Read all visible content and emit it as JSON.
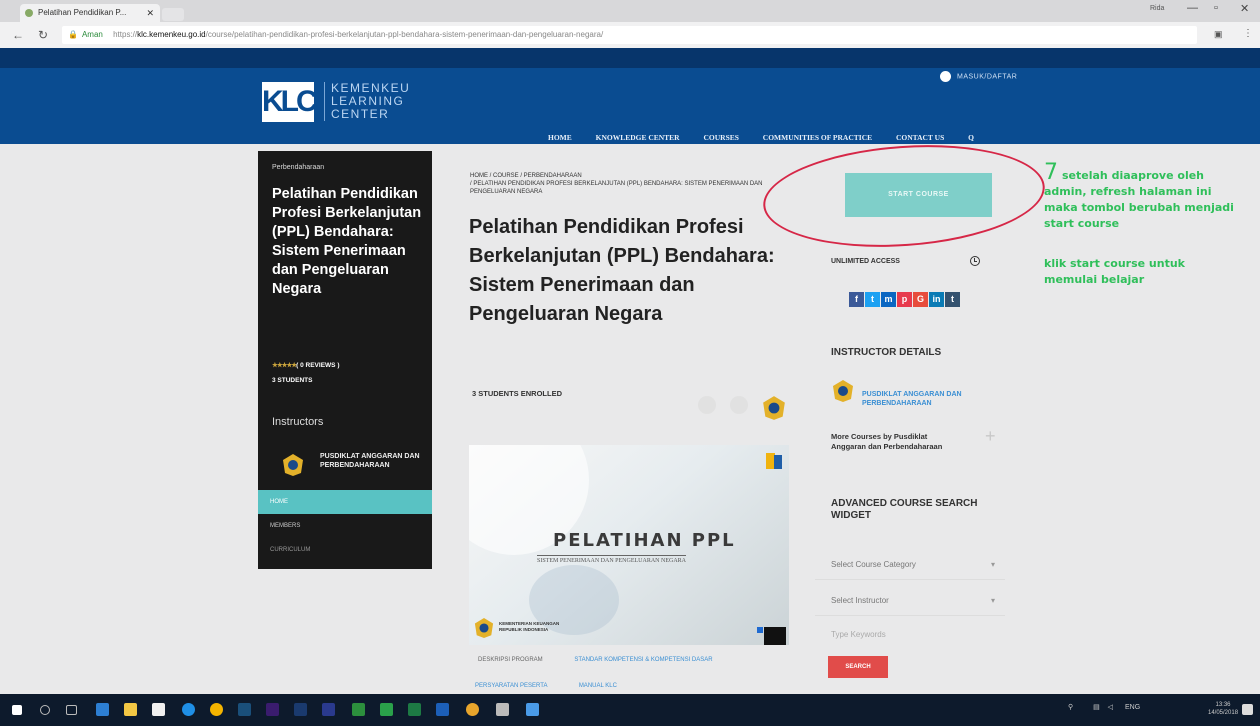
{
  "browser": {
    "tab_title": "Pelatihan Pendidikan P...",
    "address_secure_label": "Aman",
    "address_scheme": "https://",
    "address_host": "klc.kemenkeu.go.id",
    "address_path": "/course/pelatihan-pendidikan-profesi-berkelanjutan-ppl-bendahara-sistem-penerimaan-dan-pengeluaran-negara/",
    "profile_label": "Rida"
  },
  "site": {
    "logo_mark": "KLC",
    "logo_lines": [
      "KEMENKEU",
      "LEARNING",
      "CENTER"
    ],
    "login_label": "MASUK/DAFTAR",
    "nav": [
      "HOME",
      "KNOWLEDGE CENTER",
      "COURSES",
      "COMMUNITIES OF PRACTICE",
      "CONTACT US"
    ],
    "search_glyph": "Q"
  },
  "sidebar": {
    "breadcrumb": "Perbendaharaan",
    "title": "Pelatihan Pendidikan Profesi Berkelanjutan (PPL) Bendahara: Sistem Penerimaan dan Pengeluaran Negara",
    "stars": "★★★★★",
    "reviews": "( 0 REVIEWS )",
    "students": "3 STUDENTS",
    "instructors_heading": "Instructors",
    "instructor_name": "PUSDIKLAT ANGGARAN DAN PERBENDAHARAAN",
    "menu": [
      "HOME",
      "MEMBERS",
      "CURRICULUM"
    ]
  },
  "main": {
    "breadcrumb_line1": "HOME  /  COURSE  /  PERBENDAHARAAN",
    "breadcrumb_line2": "/  PELATIHAN PENDIDIKAN PROFESI BERKELANJUTAN (PPL) BENDAHARA: SISTEM PENERIMAAN DAN PENGELUARAN NEGARA",
    "title": "Pelatihan Pendidikan Profesi Berkelanjutan (PPL) Bendahara: Sistem Penerimaan dan Pengeluaran Negara",
    "enrolled": "3 STUDENTS ENROLLED",
    "image_title": "PELATIHAN PPL",
    "image_subtitle": "SISTEM PENERIMAAN DAN PENGELUARAN NEGARA",
    "image_org_line1": "KEMENTERIAN KEUANGAN",
    "image_org_line2": "REPUBLIK INDONESIA",
    "tabs": [
      "DESKRIPSI PROGRAM",
      "STANDAR KOMPETENSI & KOMPETENSI DASAR",
      "PERSYARATAN PESERTA",
      "MANUAL KLC"
    ]
  },
  "right": {
    "start_button": "START COURSE",
    "unlimited_access": "UNLIMITED ACCESS",
    "share": [
      {
        "glyph": "f",
        "color": "#3b5998"
      },
      {
        "glyph": "t",
        "color": "#1da1f2"
      },
      {
        "glyph": "m",
        "color": "#0a66c2"
      },
      {
        "glyph": "p",
        "color": "#e73a4d"
      },
      {
        "glyph": "G",
        "color": "#e74c3c"
      },
      {
        "glyph": "in",
        "color": "#0a7bb5"
      },
      {
        "glyph": "t",
        "color": "#34526f"
      }
    ],
    "instructor_heading": "INSTRUCTOR DETAILS",
    "instructor_link": "PUSDIKLAT ANGGARAN DAN PERBENDAHARAAN",
    "more_courses": "More Courses by Pusdiklat Anggaran dan Perbendaharaan",
    "adv_search_heading": "ADVANCED COURSE SEARCH WIDGET",
    "select_category": "Select Course Category",
    "select_instructor": "Select Instructor",
    "keyword_placeholder": "Type Keywords",
    "search_button": "SEARCH"
  },
  "annotation": {
    "step": "7",
    "text1": "setelah diaaprove oleh admin, refresh halaman ini maka tombol berubah menjadi start course",
    "text2": "klik start course untuk memulai belajar"
  },
  "taskbar": {
    "language": "ENG",
    "time": "13:36",
    "date": "14/05/2018"
  }
}
